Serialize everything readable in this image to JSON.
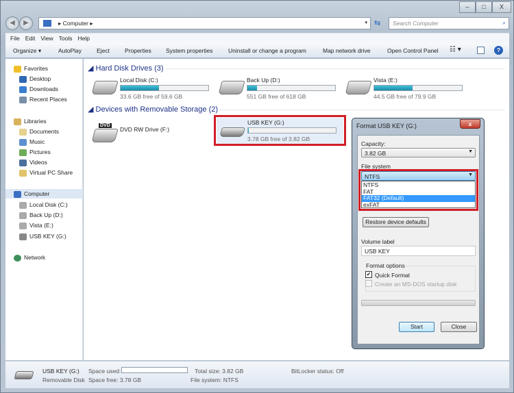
{
  "window": {
    "minimize": "–",
    "maximize": "□",
    "close": "X"
  },
  "address": {
    "path": "Computer",
    "search_placeholder": "Search Computer"
  },
  "menu": [
    "File",
    "Edit",
    "View",
    "Tools",
    "Help"
  ],
  "toolbar": [
    "Organize ▾",
    "AutoPlay",
    "Eject",
    "Properties",
    "System properties",
    "Uninstall or change a program",
    "Map network drive",
    "Open Control Panel"
  ],
  "nav": {
    "favorites": "Favorites",
    "fav_items": [
      "Desktop",
      "Downloads",
      "Recent Places"
    ],
    "libraries": "Libraries",
    "lib_items": [
      "Documents",
      "Music",
      "Pictures",
      "Videos",
      "Virtual PC Share"
    ],
    "computer": "Computer",
    "comp_items": [
      "Local Disk (C:)",
      "Back Up (D:)",
      "Vista (E:)",
      "USB KEY (G:)"
    ],
    "network": "Network"
  },
  "groups": {
    "hdd": "Hard Disk Drives (3)",
    "removable": "Devices with Removable Storage (2)"
  },
  "drives": [
    {
      "name": "Local Disk (C:)",
      "free": "33.6 GB free of 59.6 GB",
      "used_fraction": 0.44
    },
    {
      "name": "Back Up (D:)",
      "free": "551 GB free of 618 GB",
      "used_fraction": 0.11
    },
    {
      "name": "Vista (E:)",
      "free": "44.5 GB free of 79.9 GB",
      "used_fraction": 0.44
    }
  ],
  "dvd": {
    "name": "DVD RW Drive (F:)",
    "badge": "DVD"
  },
  "usb": {
    "name": "USB KEY (G:)",
    "free": "3.78 GB free of 3.82 GB",
    "used_fraction": 0.01
  },
  "dialog": {
    "title": "Format USB KEY (G:)",
    "close": "x",
    "capacity_label": "Capacity:",
    "capacity": "3.82 GB",
    "fs_label": "File system",
    "fs_selected": "NTFS",
    "fs_options": [
      "NTFS",
      "FAT",
      "FAT32 (Default)",
      "exFAT"
    ],
    "fs_highlighted": "FAT32 (Default)",
    "restore": "Restore device defaults",
    "volume_label": "Volume label",
    "volume_value": "USB KEY",
    "format_options": "Format options",
    "quick_format": "Quick Format",
    "quick_checked": true,
    "msdos": "Create an MS-DOS startup disk",
    "msdos_checked": false,
    "progress": 0,
    "start": "Start",
    "close_btn": "Close"
  },
  "status": {
    "name": "USB KEY (G:)",
    "type": "Removable Disk",
    "space_used_label": "Space used:",
    "space_free": "Space free: 3.78 GB",
    "total": "Total size: 3.82 GB",
    "fs": "File system: NTFS",
    "bitlocker": "BitLocker status: Off"
  },
  "colors": {
    "accent": "#3399ff",
    "highlight": "#d11e26",
    "bar": "#1d8ba9"
  }
}
